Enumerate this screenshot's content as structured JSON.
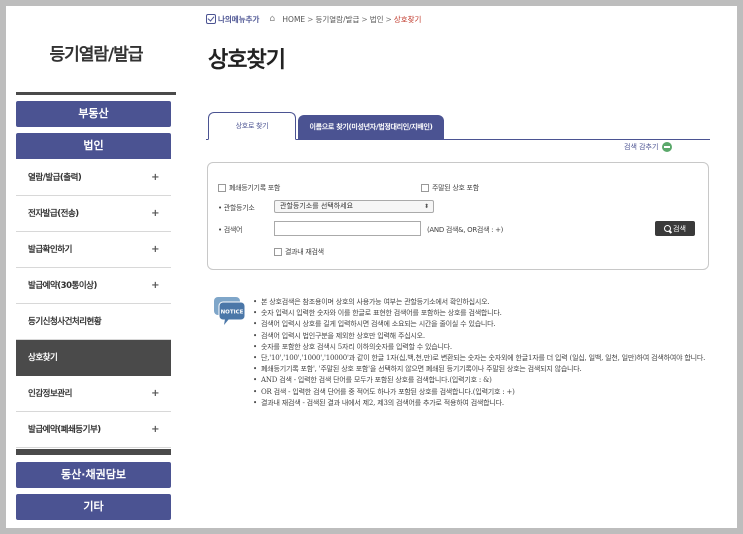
{
  "sidebar": {
    "title": "등기열람/발급",
    "btn_realestate": "부동산",
    "btn_corporation": "법인",
    "items": [
      {
        "label": "열람/발급(출력)",
        "plus": "+"
      },
      {
        "label": "전자발급(전송)",
        "plus": "+"
      },
      {
        "label": "발급확인하기",
        "plus": "+"
      },
      {
        "label": "발급예약(30통이상)",
        "plus": "+"
      },
      {
        "label": "등기신청사건처리현황",
        "plus": ""
      },
      {
        "label": "상호찾기",
        "plus": ""
      },
      {
        "label": "인감정보관리",
        "plus": "+"
      },
      {
        "label": "발급예약(폐쇄등기부)",
        "plus": "+"
      }
    ],
    "btn_movable": "동산·채권담보",
    "btn_etc": "기타"
  },
  "topnav": {
    "mymenu": "나의메뉴추가",
    "crumbs": [
      "HOME",
      "등기열람/발급",
      "법인",
      "상호찾기"
    ],
    "sep": ">"
  },
  "page_title": "상호찾기",
  "tabs": [
    {
      "label": "상호로 찾기"
    },
    {
      "label": "이름으로 찾기(미성년자/법정대리인/지배인)"
    }
  ],
  "search_toggle": "검색 감추기",
  "search": {
    "cb_closed": "폐쇄등기기록 포함",
    "cb_dormant": "주말된 상호 포함",
    "label_office": "관할등기소",
    "select_value": "관할등기소를 선택하세요",
    "label_search": "검색어",
    "hint": "(AND 검색&, OR검색 : +)",
    "btn_label": "검색",
    "cb_research": "결과내 재검색",
    "bullet": "•"
  },
  "notice": {
    "icon_label": "NOTICE",
    "items": [
      "본 상호검색은 참조용이며 상호의 사용가능 여부는 관할등기소에서 확인하십시오.",
      "숫자 입력시 입력한 숫자와 이를 한글로 표현한 검색어를 포함하는 상호를 검색합니다.",
      "검색어 입력시 상호를 길게 입력하시면 검색에 소요되는 시간을 줄이실 수 있습니다.",
      "검색어 입력시 법인구분을 제외한 상호만 입력해 주십시오.",
      "숫자를 포함한 상호 검색시 5자리 이하의숫자를 입력할 수 있습니다.",
      "단,'10','100','1000','10000'과 같이 한글 1자(십,백,천,만)로 변환되는 숫자는 숫자외에 한글1자를 더 입력 (일십, 일백, 일천, 일만)하여 검색하여야 합니다.",
      "폐쇄등기기록 포함', '주말된 상호 포함'을 선택하지 않으면 폐쇄된 등기기록이나 주말된 상호는 검색되지 않습니다.",
      "AND 검색 - 입력한 검색 단어를 모두가 포함된 상호를 검색합니다.(입력기호 : &)",
      "OR 검색 - 입력한 검색 단어를 중 적어도 하나가 포함된 상호를 검색합니다.(입력기호 : +)",
      "결과내 재검색 - 검색된 결과 내에서 제2, 제3의 검색어를 추가로 적용하여 검색합니다."
    ]
  },
  "colors": {
    "accent": "#4b5392",
    "active_item": "#4a4a4a",
    "crumb_current": "#c0392b",
    "toggle": "#5aa86a"
  }
}
